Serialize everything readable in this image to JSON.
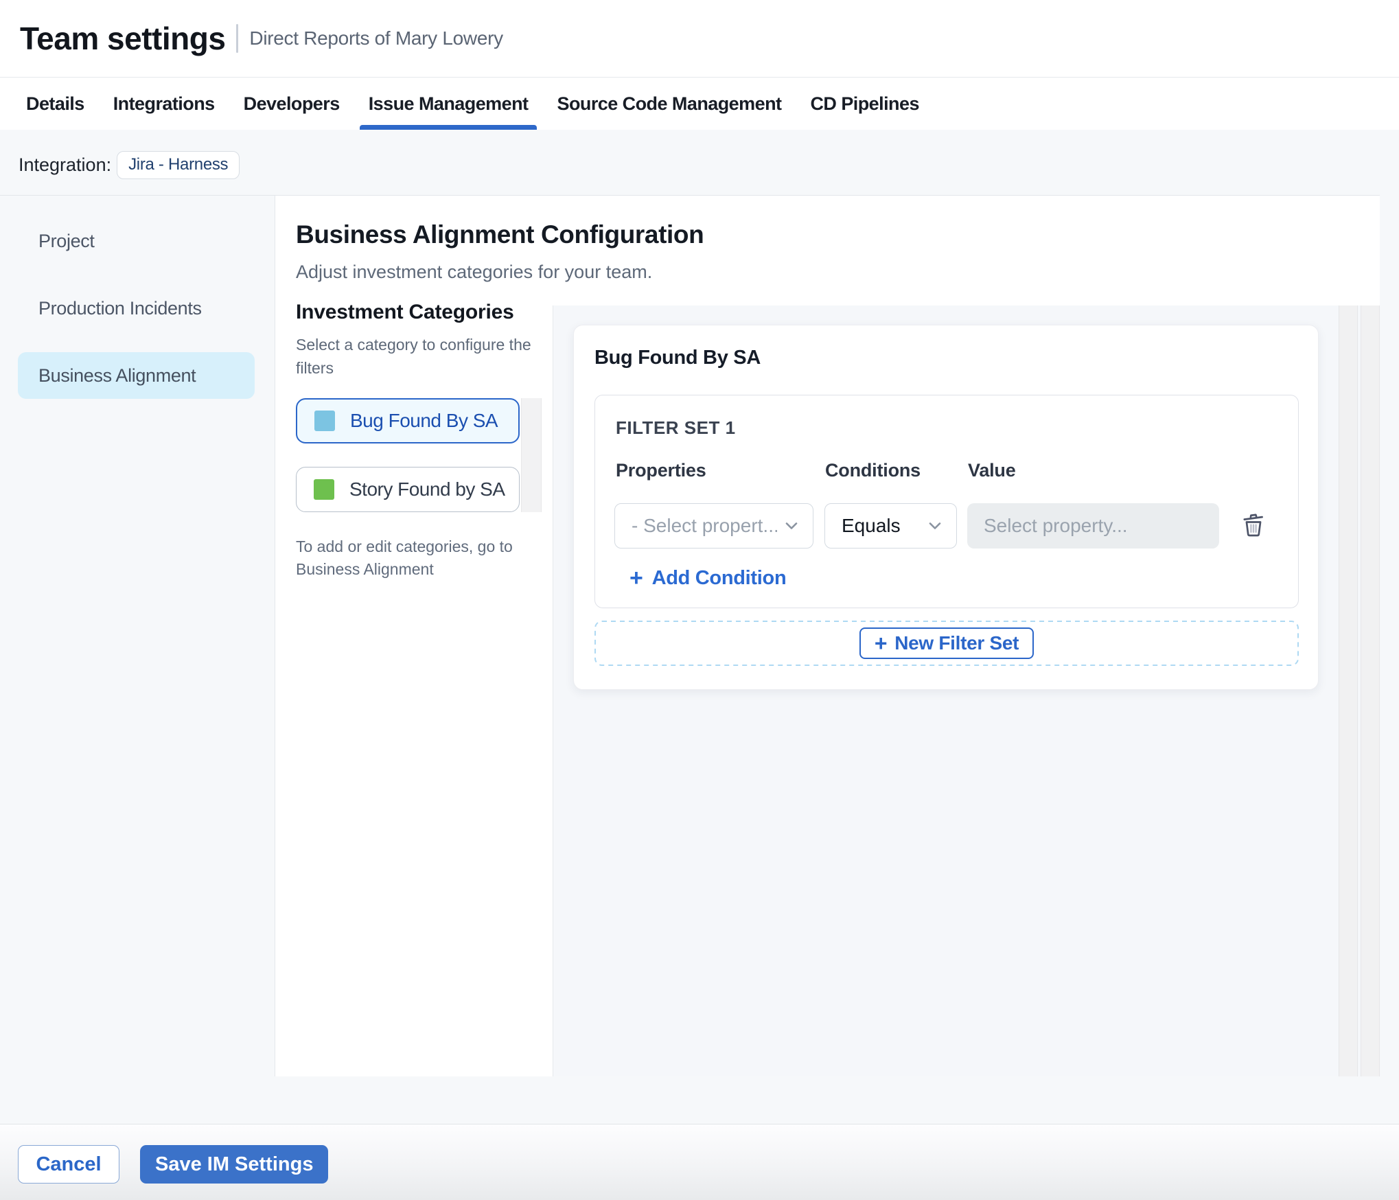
{
  "header": {
    "title": "Team settings",
    "subtitle": "Direct Reports of Mary Lowery"
  },
  "tabs": {
    "items": [
      {
        "label": "Details",
        "active": false
      },
      {
        "label": "Integrations",
        "active": false
      },
      {
        "label": "Developers",
        "active": false
      },
      {
        "label": "Issue Management",
        "active": true
      },
      {
        "label": "Source Code Management",
        "active": false
      },
      {
        "label": "CD Pipelines",
        "active": false
      }
    ]
  },
  "integration": {
    "label": "Integration:",
    "chip": "Jira - Harness"
  },
  "sidebar": {
    "items": [
      {
        "label": "Project",
        "selected": false
      },
      {
        "label": "Production Incidents",
        "selected": false
      },
      {
        "label": "Business Alignment",
        "selected": true
      }
    ]
  },
  "main": {
    "heading": "Business Alignment Configuration",
    "subheading": "Adjust investment categories for your team.",
    "categories": {
      "title": "Investment Categories",
      "helper": "Select a category to configure the filters",
      "items": [
        {
          "label": "Bug Found By SA",
          "color": "#7cc4e2",
          "selected": true
        },
        {
          "label": "Story Found by SA",
          "color": "#6ec04e",
          "selected": false
        }
      ],
      "note": "To add or edit categories, go to Business Alignment"
    },
    "filter_panel": {
      "title": "Bug Found By SA",
      "filter_set_label": "FILTER SET 1",
      "columns": {
        "properties": "Properties",
        "conditions": "Conditions",
        "value": "Value"
      },
      "property_select_value": "- Select propert...",
      "condition_select_value": "Equals",
      "value_placeholder": "Select property...",
      "add_condition_label": "Add Condition",
      "new_filter_set_label": "New Filter Set"
    }
  },
  "footer": {
    "cancel_label": "Cancel",
    "save_label": "Save IM Settings"
  },
  "colors": {
    "accent_blue": "#2b66c9",
    "selected_nav_bg": "#d7f0fb",
    "bug_swatch": "#7cc4e2",
    "story_swatch": "#6ec04e",
    "save_button_bg": "#3b72c9"
  }
}
